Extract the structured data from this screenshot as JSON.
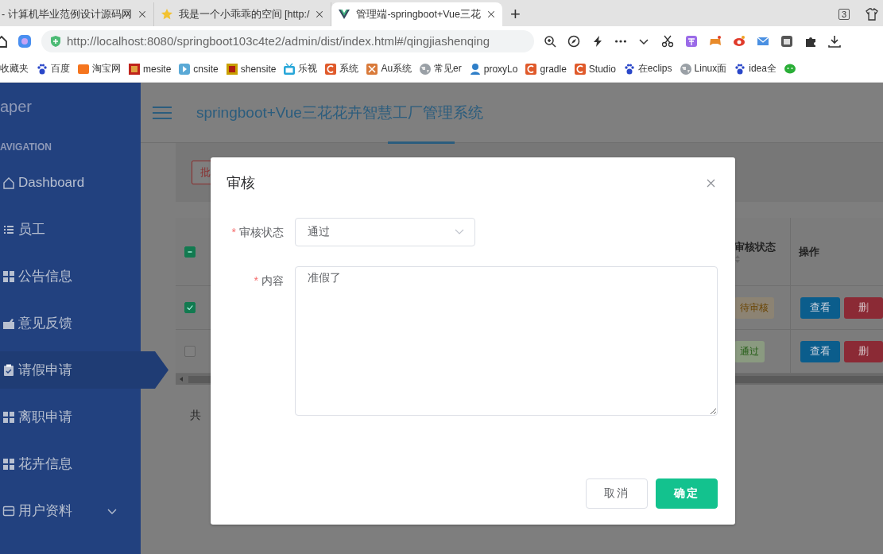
{
  "browser": {
    "tabs": [
      {
        "title": "- 计算机毕业范例设计源码网",
        "kind": "plain",
        "selected": false
      },
      {
        "title": "我是一个小乖乖的空间 [http:/",
        "kind": "star",
        "selected": false
      },
      {
        "title": "管理端-springboot+Vue三花",
        "kind": "app",
        "selected": true
      }
    ],
    "new_tab": "+",
    "tab_count": "3",
    "url": "http://localhost:8080/springboot103c4te2/admin/dist/index.html#/qingjiashenqing",
    "bookmarks": [
      {
        "label": "收藏夹",
        "kind": "none"
      },
      {
        "label": "百度",
        "kind": "paw"
      },
      {
        "label": "淘宝网",
        "kind": "tao"
      },
      {
        "label": "mesite",
        "kind": "redsq"
      },
      {
        "label": "cnsite",
        "kind": "play"
      },
      {
        "label": "shensite",
        "kind": "shen"
      },
      {
        "label": "乐视",
        "kind": "tv"
      },
      {
        "label": "系统",
        "kind": "c"
      },
      {
        "label": "Au系统",
        "kind": "au"
      },
      {
        "label": "常见er",
        "kind": "globe"
      },
      {
        "label": "proxyLo",
        "kind": "person"
      },
      {
        "label": "gradle",
        "kind": "c"
      },
      {
        "label": "Studio",
        "kind": "c"
      },
      {
        "label": "在eclips",
        "kind": "paw"
      },
      {
        "label": "Linux面",
        "kind": "globe"
      },
      {
        "label": "idea全",
        "kind": "paw"
      },
      {
        "kind": "chat"
      }
    ]
  },
  "sidebar": {
    "logo": "aper",
    "heading": "AVIGATION",
    "items": [
      {
        "label": "Dashboard",
        "kind": "home",
        "selected": false
      },
      {
        "label": "员工",
        "kind": "list",
        "selected": false
      },
      {
        "label": "公告信息",
        "kind": "grid",
        "selected": false
      },
      {
        "label": "意见反馈",
        "kind": "bag",
        "selected": false
      },
      {
        "label": "请假申请",
        "kind": "clipboard",
        "selected": true
      },
      {
        "label": "离职申请",
        "kind": "grid",
        "selected": false
      },
      {
        "label": "花卉信息",
        "kind": "grid",
        "selected": false
      },
      {
        "label": "用户资料",
        "kind": "card",
        "selected": false,
        "expanded": false
      }
    ]
  },
  "header": {
    "title": "springboot+Vue三花花卉智慧工厂管理系统"
  },
  "toolbar": {
    "button": "批"
  },
  "table": {
    "select_all_indeterminate": true,
    "columns": [
      "审核状态",
      "操作"
    ],
    "rows": [
      {
        "checked": true,
        "status": "待审核",
        "kind": "pending",
        "actions": [
          {
            "label": "查看",
            "kind": "view"
          },
          {
            "label": "删",
            "kind": "delete"
          }
        ]
      },
      {
        "checked": false,
        "status": "通过",
        "kind": "approved",
        "actions": [
          {
            "label": "查看",
            "kind": "view"
          },
          {
            "label": "删",
            "kind": "delete"
          }
        ]
      }
    ]
  },
  "pagination": {
    "text": "共"
  },
  "dialog": {
    "title": "审核",
    "fields": [
      {
        "label": "审核状态",
        "required_mark": "*",
        "kind": "select",
        "value": "通过"
      },
      {
        "label": "内容",
        "required_mark": "*",
        "kind": "textarea",
        "value": "准假了"
      }
    ],
    "buttons": [
      {
        "label": "取消",
        "kind": "default"
      },
      {
        "label": "确定",
        "kind": "primary"
      }
    ]
  }
}
